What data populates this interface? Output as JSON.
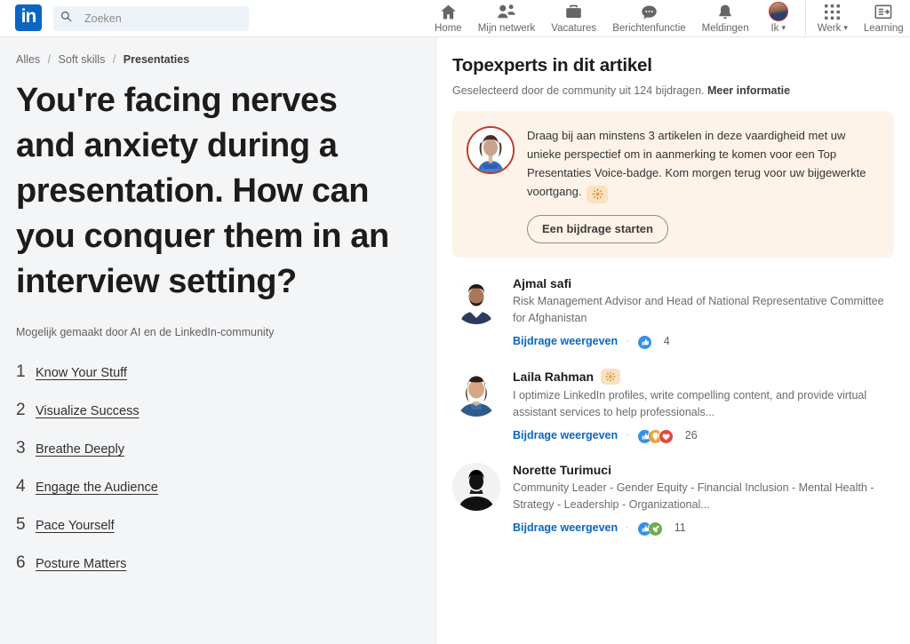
{
  "nav": {
    "logo_text": "in",
    "logo_name": "linkedin-logo",
    "search_placeholder": "Zoeken",
    "search_value": "",
    "search_icon": "search-icon",
    "items": [
      {
        "label": "Home",
        "icon": "home-icon"
      },
      {
        "label": "Mijn netwerk",
        "icon": "network-icon"
      },
      {
        "label": "Vacatures",
        "icon": "briefcase-icon"
      },
      {
        "label": "Berichtenfunctie",
        "icon": "message-icon"
      },
      {
        "label": "Meldingen",
        "icon": "bell-icon"
      },
      {
        "label": "Ik",
        "icon": "avatar-icon",
        "caret": "▾"
      },
      {
        "label": "Werk",
        "icon": "grid-icon",
        "caret": "▾"
      },
      {
        "label": "Learning",
        "icon": "learning-icon"
      }
    ]
  },
  "breadcrumb": {
    "items": [
      "Alles",
      "Soft skills",
      "Presentaties"
    ],
    "separator": "/"
  },
  "article": {
    "title": "You're facing nerves and anxiety during a presentation. How can you conquer them in an interview setting?",
    "byline": "Mogelijk gemaakt door AI en de LinkedIn-community"
  },
  "toc": [
    {
      "num": "1",
      "label": "Know Your Stuff"
    },
    {
      "num": "2",
      "label": "Visualize Success"
    },
    {
      "num": "3",
      "label": "Breathe Deeply"
    },
    {
      "num": "4",
      "label": "Engage the Audience"
    },
    {
      "num": "5",
      "label": "Pace Yourself"
    },
    {
      "num": "6",
      "label": "Posture Matters"
    }
  ],
  "experts_panel": {
    "title": "Topexperts in dit artikel",
    "subtitle": "Geselecteerd door de community uit 124 bijdragen.",
    "more_link": "Meer informatie",
    "promo": {
      "avatar_name": "promo-avatar",
      "text": "Draag bij aan minstens 3 artikelen in deze vaardigheid met uw unieke perspectief om in aanmerking te komen voor een Top Presentaties Voice-badge. Kom morgen terug voor uw bijgewerkte voortgang.",
      "badge_icon": "sun-badge-icon",
      "button_label": "Een bijdrage starten",
      "bg_color": "#fdf3e8"
    },
    "experts": [
      {
        "name": "Ajmal safi",
        "badge": null,
        "headline": "Risk Management Advisor and Head of National Representative Committee for Afghanistan",
        "view_label": "Bijdrage weergeven",
        "reactions": [
          "like"
        ],
        "reaction_count": "4"
      },
      {
        "name": "Laila Rahman",
        "badge": "sun-badge-icon",
        "headline": "I optimize LinkedIn profiles, write compelling content, and provide virtual assistant services to help professionals...",
        "view_label": "Bijdrage weergeven",
        "reactions": [
          "like",
          "insightful",
          "love"
        ],
        "reaction_count": "26"
      },
      {
        "name": "Norette Turimuci",
        "badge": null,
        "headline": "Community Leader - Gender Equity - Financial Inclusion - Mental Health - Strategy - Leadership - Organizational...",
        "view_label": "Bijdrage weergeven",
        "reactions": [
          "like",
          "support"
        ],
        "reaction_count": "11"
      }
    ]
  },
  "colors": {
    "brand_blue": "#0a66c2",
    "left_bg": "#f4f5f7",
    "promo_bg": "#fdf3e8",
    "reaction_like": "#378fe9",
    "reaction_insightful": "#e7a33e",
    "reaction_love": "#df704d",
    "reaction_support": "#6dae4f"
  }
}
